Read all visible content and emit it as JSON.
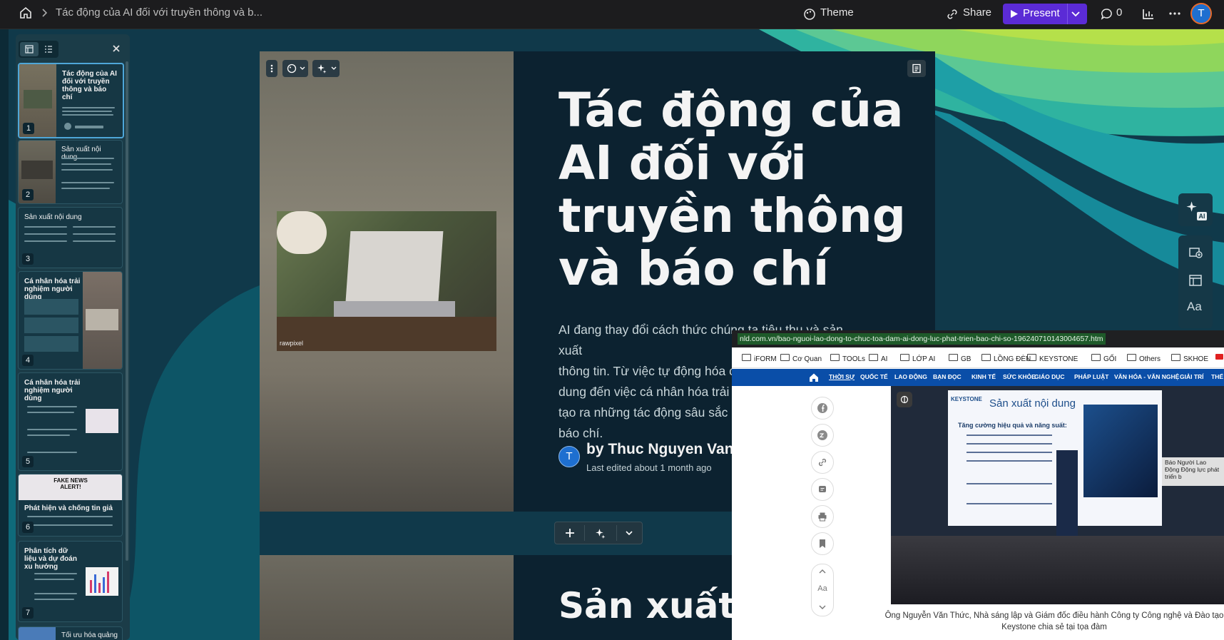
{
  "topbar": {
    "breadcrumb_title": "Tác động của AI đối với truyền thông và b...",
    "theme_label": "Theme",
    "share_label": "Share",
    "present_label": "Present",
    "comments_count": "0",
    "avatar_initial": "T",
    "accent_color": "#5b2bd6"
  },
  "sidebar": {
    "thumbnails": [
      {
        "num": "1",
        "title": "Tác động của AI đối với truyền thông và báo chí"
      },
      {
        "num": "2",
        "title": "Sản xuất nội dung"
      },
      {
        "num": "3",
        "title": "Sản xuất nội dung"
      },
      {
        "num": "4",
        "title": "Cá nhân hóa trải nghiệm người dùng"
      },
      {
        "num": "5",
        "title": "Cá nhân hóa trải nghiệm người dùng"
      },
      {
        "num": "6",
        "title": "Phát hiện và chống tin giả",
        "banner": "FAKE NEWS ALERT!"
      },
      {
        "num": "7",
        "title": "Phân tích dữ liệu và dự đoán xu hướng"
      },
      {
        "num": "",
        "title": "Tối ưu hóa quảng"
      }
    ]
  },
  "slide": {
    "title": "Tác động của AI đối với truyền thông và báo chí",
    "body": "AI đang thay đổi cách thức chúng ta tiêu thụ và sản xuất thông tin. Từ việc tự động hóa c... dung đến việc cá nhân hóa trải n... tạo ra những tác động sâu sắc đ... báo chí.",
    "body_lines": [
      "AI đang thay đổi cách thức chúng ta tiêu thụ và sản xuất",
      "thông tin. Từ việc tự động hóa c",
      "dung đến việc cá nhân hóa trải n",
      "tạo ra những tác động sâu sắc đ",
      "báo chí."
    ],
    "author": "by Thuc Nguyen Van",
    "author_initial": "T",
    "last_edited": "Last edited about 1 month ago",
    "image_credit": "rawpixel",
    "next_slide_title": "Sản xuất"
  },
  "browser": {
    "url": "nld.com.vn/bao-nguoi-lao-dong-to-chuc-toa-dam-ai-dong-luc-phat-trien-bao-chi-so-196240710143004657.htm",
    "bookmarks": [
      "iFORM",
      "Cơ Quan",
      "TOOLs",
      "AI",
      "LỚP AI",
      "GB",
      "LỒNG ĐÈN",
      "KEYSTONE",
      "GỐI",
      "Others",
      "SKHOE",
      "YouTu"
    ],
    "nav_items": [
      "THỜI SỰ",
      "QUỐC TẾ",
      "LAO ĐỘNG",
      "BẠN ĐỌC",
      "KINH TẾ",
      "SỨC KHỎE",
      "GIÁO DỤC",
      "PHÁP LUẬT",
      "VĂN HÓA - VĂN NGHỆ",
      "GIẢI TRÍ",
      "THỂ"
    ],
    "font_size_label": "Aa",
    "photo_slide_title": "Sản xuất nội dung",
    "photo_slide_subtitle": "Tăng cường hiệu quả và năng suất:",
    "photo_logo": "KEYSTONE",
    "photo_banner": "Báo Người Lao Động Động lực phát triển b",
    "caption": "Ông Nguyễn Văn Thức, Nhà sáng lập và Giám đốc điều hành Công ty Công nghệ và Đào tạo Keystone chia sẻ tại tọa đàm"
  },
  "tools": {
    "ai_label": "AI",
    "font_label": "Aa"
  }
}
